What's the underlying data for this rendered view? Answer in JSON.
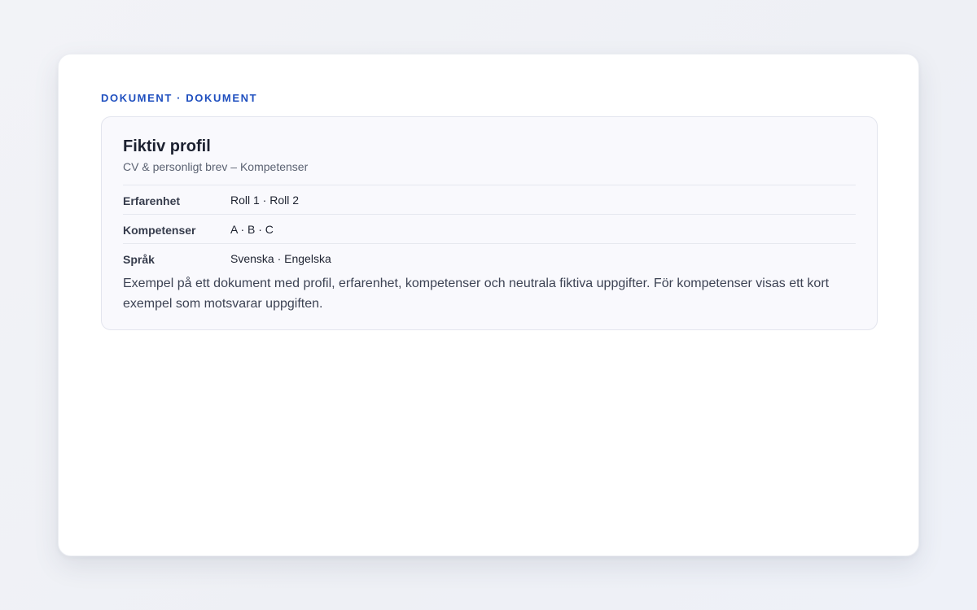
{
  "header": {
    "eyebrow": "DOKUMENT · DOKUMENT"
  },
  "profile": {
    "title": "Fiktiv profil",
    "subtitle": "CV & personligt brev – Kompetenser",
    "rows": [
      {
        "label": "Erfarenhet",
        "value": "Roll 1 · Roll 2"
      },
      {
        "label": "Kompetenser",
        "value": "A · B · C"
      },
      {
        "label": "Språk",
        "value": "Svenska · Engelska"
      }
    ],
    "description": "Exempel på ett dokument med profil, erfarenhet, kompetenser och neutrala fiktiva uppgifter. För kompetenser visas ett kort exempel som motsvarar uppgiften."
  },
  "colors": {
    "accent": "#1f4fbf",
    "background": "#f2f3f7",
    "card": "#ffffff",
    "panel": "#f9f9fd"
  }
}
